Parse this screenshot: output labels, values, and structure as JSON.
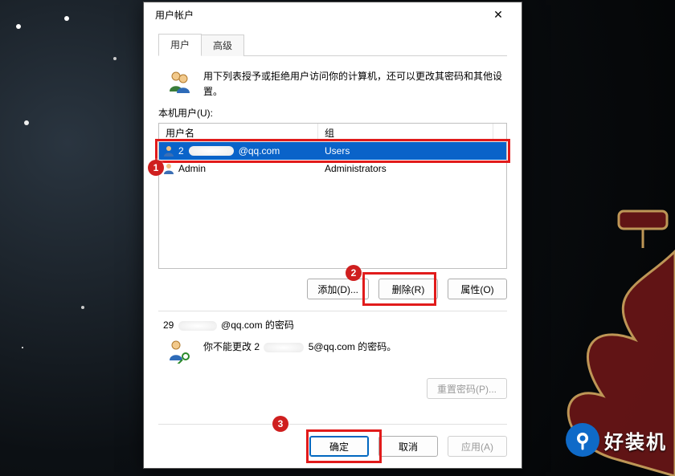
{
  "dialog": {
    "title": "用户帐户",
    "close_glyph": "✕"
  },
  "tabs": {
    "users": "用户",
    "advanced": "高级"
  },
  "intro": {
    "text": "用下列表授予或拒绝用户访问你的计算机，还可以更改其密码和其他设置。"
  },
  "local_users_label": "本机用户(U):",
  "columns": {
    "username": "用户名",
    "group": "组"
  },
  "rows": [
    {
      "name_prefix": "2",
      "name_suffix": "@qq.com",
      "group": "Users"
    },
    {
      "name_prefix": "Admin",
      "name_suffix": "",
      "group": "Administrators"
    }
  ],
  "buttons": {
    "add": "添加(D)...",
    "remove": "删除(R)",
    "properties": "属性(O)",
    "reset_pw": "重置密码(P)...",
    "ok": "确定",
    "cancel": "取消",
    "apply": "应用(A)"
  },
  "password_section": {
    "title_prefix": "29",
    "title_suffix": "@qq.com 的密码",
    "line_prefix": "你不能更改 2",
    "line_suffix": "5@qq.com 的密码。"
  },
  "badges": {
    "1": "1",
    "2": "2",
    "3": "3"
  },
  "brand": {
    "text": "好装机"
  }
}
